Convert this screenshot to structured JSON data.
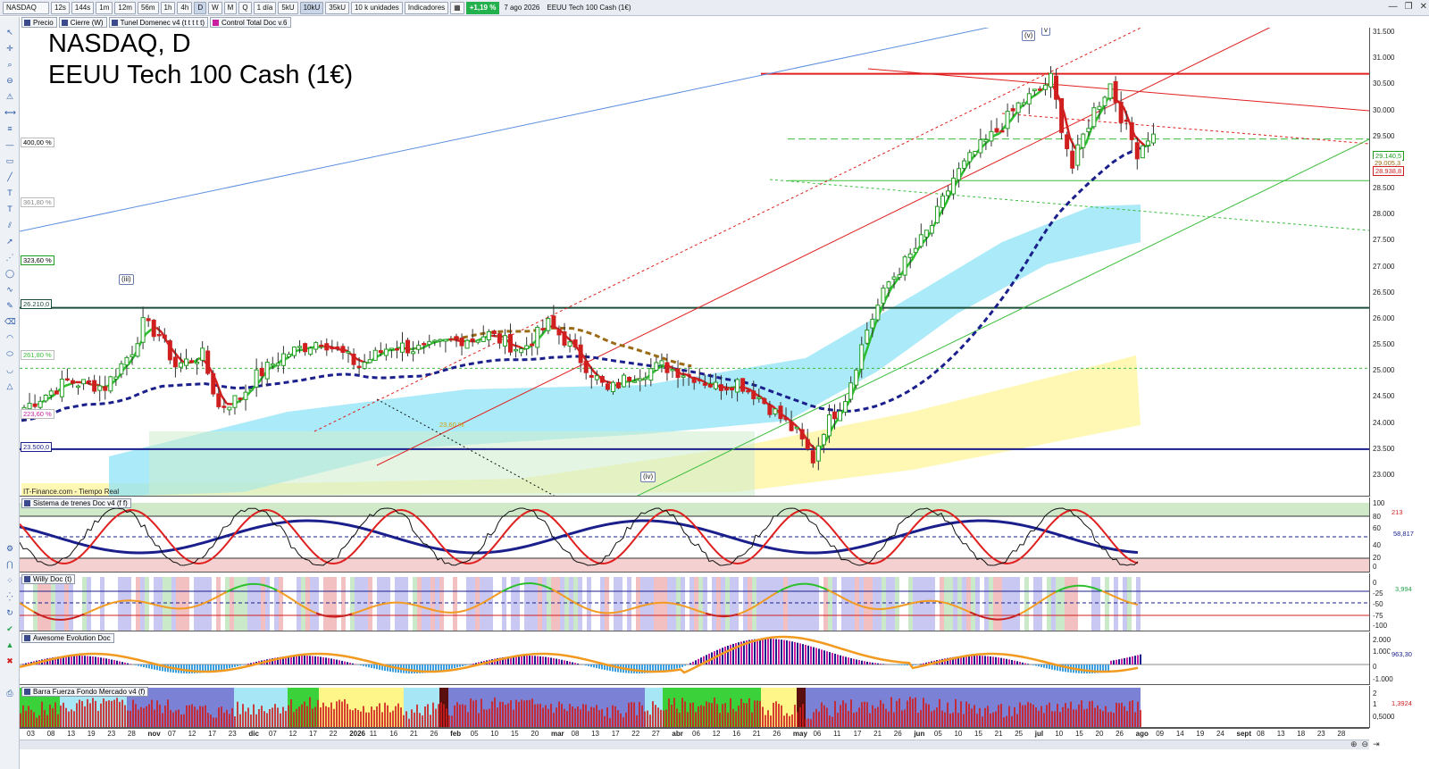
{
  "toolbar": {
    "symbol": "NASDAQ",
    "timeframes": [
      "12s",
      "144s",
      "1m",
      "12m",
      "56m",
      "1h",
      "4h",
      "D",
      "W",
      "M",
      "Q"
    ],
    "period": "1 día",
    "ticks": [
      "5kU",
      "10kU",
      "35kU"
    ],
    "units": "10 k unidades",
    "indicators_label": "Indicadores",
    "change_pct": "+1,19 %",
    "date": "7 ago 2026",
    "instrument": "EEUU Tech 100 Cash (1€)"
  },
  "tags": [
    "Precio",
    "Cierre (W)",
    "Tunel Domenec v4 (t t t t t)",
    "Control Total Doc v.6"
  ],
  "chart": {
    "title_line1": "NASDAQ, D",
    "title_line2": "EEUU Tech 100 Cash (1€)",
    "credit": "IT-Finance.com - Tiempo Real",
    "fib_labels": [
      "400,00 %",
      "361,80 %",
      "323,60 %",
      "261,80 %",
      "223,60 %"
    ],
    "level_labels": [
      "26.210,0",
      "23.500,0"
    ],
    "fib_text": "23,60 %",
    "waves": [
      "(iii)",
      "(iv)",
      "(v)",
      "v"
    ],
    "price_ticks": [
      "31.500",
      "31.000",
      "30.500",
      "30.000",
      "29.500",
      "29.000",
      "28.500",
      "28.000",
      "27.500",
      "27.000",
      "26.500",
      "26.000",
      "25.500",
      "25.000",
      "24.500",
      "24.000",
      "23.500",
      "23.000"
    ],
    "price_badges": [
      "29.140,5",
      "29.005,3",
      "28.938,8"
    ],
    "colors": {
      "up": "#1f9d1f",
      "down": "#d01f1f",
      "ma_blue": "#1a1f8c",
      "ma_brown": "#9a6a14",
      "cloud_cyan": "#8fe3f5",
      "cloud_yellow": "#fff7a8"
    }
  },
  "panes": {
    "trenes": {
      "title": "Sistema de trenes Doc v4 (f f)",
      "ticks": [
        "100",
        "80",
        "60",
        "40",
        "20",
        "0"
      ],
      "badges": [
        "213",
        "58,817"
      ]
    },
    "willy": {
      "title": "Willy Doc (t)",
      "ticks": [
        "0",
        "-25",
        "-50",
        "-75",
        "-100"
      ],
      "badges": [
        "3,994"
      ]
    },
    "awesome": {
      "title": "Awesome Evolution Doc",
      "ticks": [
        "2.000",
        "1.000",
        "0",
        "-1.000"
      ],
      "badges": [
        "963,30"
      ]
    },
    "barra": {
      "title": "Barra Fuerza Fondo Mercado v4 (f)",
      "ticks": [
        "2",
        "1",
        "0,5000"
      ],
      "badges": [
        "1,3924"
      ]
    }
  },
  "xaxis": {
    "labels": [
      "03",
      "08",
      "13",
      "19",
      "23",
      "28",
      "nov",
      "07",
      "12",
      "17",
      "23",
      "dic",
      "07",
      "12",
      "17",
      "22",
      "2026",
      "11",
      "16",
      "21",
      "26",
      "feb",
      "05",
      "10",
      "15",
      "20",
      "mar",
      "08",
      "13",
      "17",
      "22",
      "27",
      "abr",
      "06",
      "12",
      "16",
      "21",
      "26",
      "may",
      "06",
      "11",
      "17",
      "21",
      "26",
      "jun",
      "05",
      "10",
      "15",
      "21",
      "25",
      "jul",
      "10",
      "15",
      "20",
      "26",
      "ago",
      "09",
      "14",
      "19",
      "24",
      "sept",
      "08",
      "13",
      "18",
      "23",
      "28"
    ]
  }
}
